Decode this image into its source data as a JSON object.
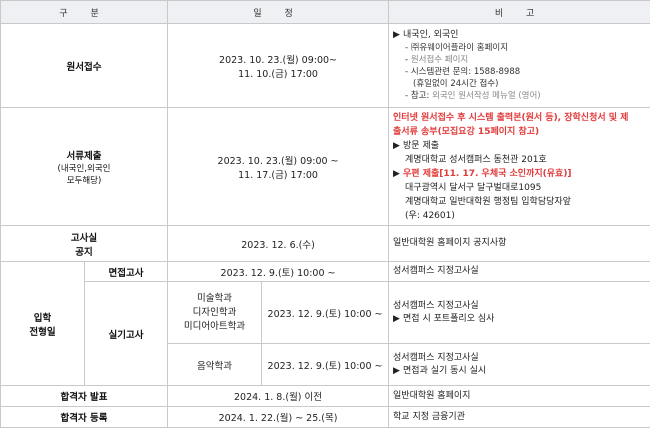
{
  "header": {
    "col1": "구 분",
    "col2": "일 정",
    "col3": "비 고"
  },
  "rows": {
    "application": {
      "label": "원서접수",
      "date_line1": "2023. 10. 23.(월) 09:00~",
      "date_line2": "11. 10.(금) 17:00",
      "notes": {
        "n1": "내국인, 외국인",
        "n2": "㈜유웨이어플라이 홈페이지",
        "n3": "원서접수 페이지",
        "n4": "시스템관련 문의: 1588-8988",
        "n5": "(휴일없이 24시간 접수)",
        "n6_prefix": "참고: ",
        "n6_link": "외국인 원서작성 메뉴얼 (영어)"
      }
    },
    "documents": {
      "label": "서류제출",
      "sublabel1": "(내국인,외국인",
      "sublabel2": "모두해당)",
      "date_line1": "2023. 10. 23.(월) 09:00 ~",
      "date_line2": "11. 17.(금) 17:00",
      "notes": {
        "red1": "인터넷 원서접수 후 시스템 출력본(원서 등), 장학신청서 및 제",
        "red2": "출서류 송부(모집요강 15페이지 참고)",
        "visit": "방문 제출",
        "visit_addr": "계명대학교 성서캠퍼스 동천관 201호",
        "mail": "우편 제출[11. 17. 우체국 소인까지(유효)]",
        "mail_addr1": "대구광역시 달서구 달구벌대로1095",
        "mail_addr2": "계명대학교 일반대학원 행정팀 입학담당자앞",
        "mail_zip": "(우: 42601)"
      }
    },
    "exam_notice": {
      "label1": "고사실",
      "label2": "공지",
      "date": "2023. 12. 6.(수)",
      "note": "일반대학원 홈페이지 공지사항"
    },
    "exam": {
      "label1": "입학",
      "label2": "전형일",
      "interview": {
        "label": "면접고사",
        "date": "2023. 12. 9.(토) 10:00 ~",
        "note": "성서캠퍼스 지정고사실"
      },
      "practical": {
        "label": "실기고사",
        "art": {
          "dept1": "미술학과",
          "dept2": "디자인학과",
          "dept3": "미디어아트학과",
          "date": "2023. 12. 9.(토) 10:00 ~",
          "note1": "성서캠퍼스 지정고사실",
          "note2": "면접 시 포트폴리오 심사"
        },
        "music": {
          "dept": "음악학과",
          "date": "2023. 12. 9.(토) 10:00 ~",
          "note1": "성서캠퍼스 지정고사실",
          "note2": "면접과 실기 동시 실시"
        }
      }
    },
    "announce": {
      "label": "합격자 발표",
      "date": "2024. 1. 8.(월) 이전",
      "note": "일반대학원 홈페이지"
    },
    "register": {
      "label": "합격자 등록",
      "date": "2024. 1. 22.(월) ~ 25.(목)",
      "note": "학교 지정 금융기관"
    }
  },
  "colors": {
    "header_bg": "#eef0f3",
    "border": "#c9c9c9",
    "accent_red": "#e23b3b"
  }
}
